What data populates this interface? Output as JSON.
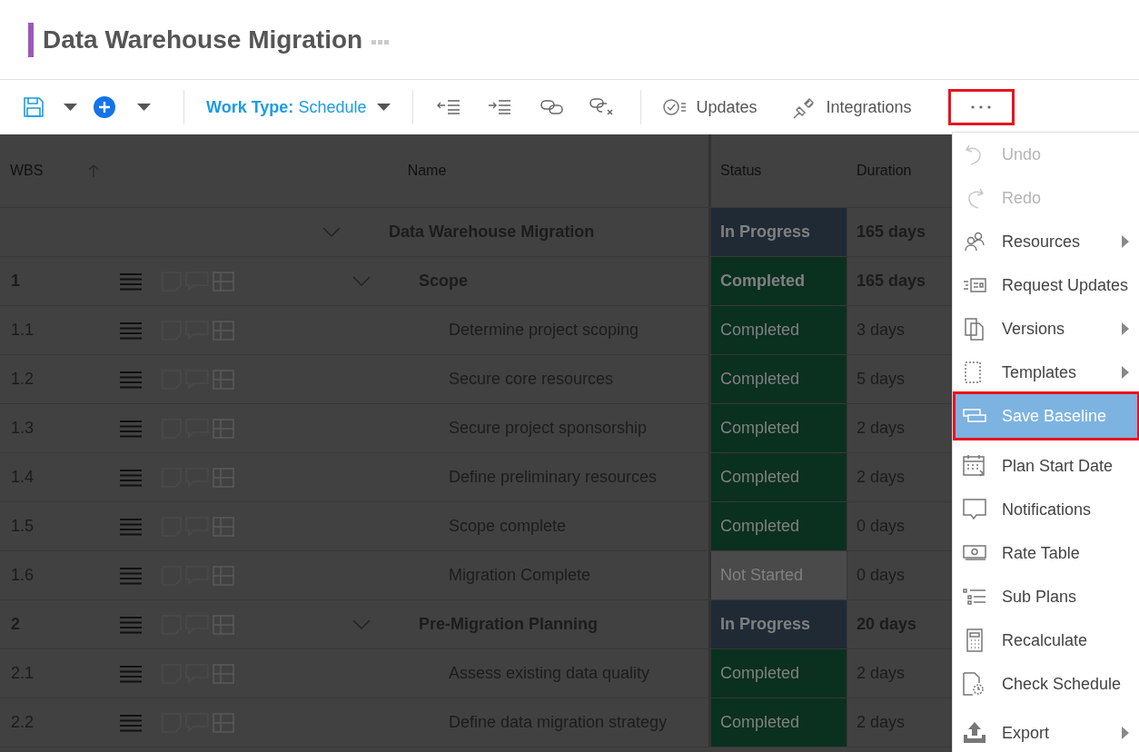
{
  "header": {
    "title": "Data Warehouse Migration"
  },
  "toolbar": {
    "work_type_label": "Work Type:",
    "work_type_value": "Schedule",
    "buttons": [
      {
        "label": "Updates"
      },
      {
        "label": "Integrations"
      }
    ],
    "more": {
      "highlighted": true
    }
  },
  "grid": {
    "columns": [
      {
        "label": "WBS",
        "sorted": true
      },
      {
        "label": "Name"
      },
      {
        "label": "Status"
      },
      {
        "label": "Duration"
      }
    ],
    "rows": [
      {
        "name": "Data Warehouse Migration",
        "status": "In Progress",
        "color": "#1f2a35",
        "duration": "165 days",
        "expanded": true,
        "children": [
          {
            "wbs": "1",
            "name": "Scope",
            "status": "Completed",
            "color": "#0a3020",
            "duration": "165 days",
            "expanded": true,
            "children": [
              {
                "wbs": "1.1",
                "name": "Determine project scoping",
                "status": "Completed",
                "color": "#0a3020",
                "duration": "3 days"
              },
              {
                "wbs": "1.2",
                "name": "Secure core resources",
                "status": "Completed",
                "color": "#0a3020",
                "duration": "5 days"
              },
              {
                "wbs": "1.3",
                "name": "Secure project sponsorship",
                "status": "Completed",
                "color": "#0a3020",
                "duration": "2 days"
              },
              {
                "wbs": "1.4",
                "name": "Define preliminary resources",
                "status": "Completed",
                "color": "#0a3020",
                "duration": "2 days"
              },
              {
                "wbs": "1.5",
                "name": "Scope complete",
                "status": "Completed",
                "color": "#0a3020",
                "duration": "0 days"
              },
              {
                "wbs": "1.6",
                "name": "Migration Complete",
                "status": "Not Started",
                "color": "#4a4a4a",
                "duration": "0 days"
              }
            ]
          },
          {
            "wbs": "2",
            "name": "Pre-Migration Planning",
            "status": "In Progress",
            "color": "#1f2a35",
            "duration": "20 days",
            "expanded": true,
            "children": [
              {
                "wbs": "2.1",
                "name": "Assess existing data quality",
                "status": "Completed",
                "color": "#0a3020",
                "duration": "2 days"
              },
              {
                "wbs": "2.2",
                "name": "Define data migration strategy",
                "status": "Completed",
                "color": "#0a3020",
                "duration": "2 days"
              }
            ]
          }
        ]
      }
    ]
  },
  "menu": {
    "groups": [
      [
        {
          "label": "Undo",
          "disabled": true,
          "submenu": false,
          "selected": false,
          "highlighted": false
        },
        {
          "label": "Redo",
          "disabled": true,
          "submenu": false,
          "selected": false,
          "highlighted": false
        },
        {
          "label": "Resources",
          "disabled": false,
          "submenu": true,
          "selected": false,
          "highlighted": false
        },
        {
          "label": "Request Updates",
          "disabled": false,
          "submenu": false,
          "selected": false,
          "highlighted": false
        },
        {
          "label": "Versions",
          "disabled": false,
          "submenu": true,
          "selected": false,
          "highlighted": false
        },
        {
          "label": "Templates",
          "disabled": false,
          "submenu": true,
          "selected": false,
          "highlighted": false
        },
        {
          "label": "Save Baseline",
          "disabled": false,
          "submenu": false,
          "selected": true,
          "highlighted": true
        },
        {
          "label": "Plan Start Date",
          "disabled": false,
          "submenu": false,
          "selected": false,
          "highlighted": false
        },
        {
          "label": "Notifications",
          "disabled": false,
          "submenu": false,
          "selected": false,
          "highlighted": false
        },
        {
          "label": "Rate Table",
          "disabled": false,
          "submenu": false,
          "selected": false,
          "highlighted": false
        },
        {
          "label": "Sub Plans",
          "disabled": false,
          "submenu": false,
          "selected": false,
          "highlighted": false
        },
        {
          "label": "Recalculate",
          "disabled": false,
          "submenu": false,
          "selected": false,
          "highlighted": false
        },
        {
          "label": "Check Schedule",
          "disabled": false,
          "submenu": false,
          "selected": false,
          "highlighted": false
        }
      ],
      [
        {
          "label": "Export",
          "disabled": false,
          "submenu": true,
          "selected": false,
          "highlighted": false
        }
      ]
    ]
  }
}
